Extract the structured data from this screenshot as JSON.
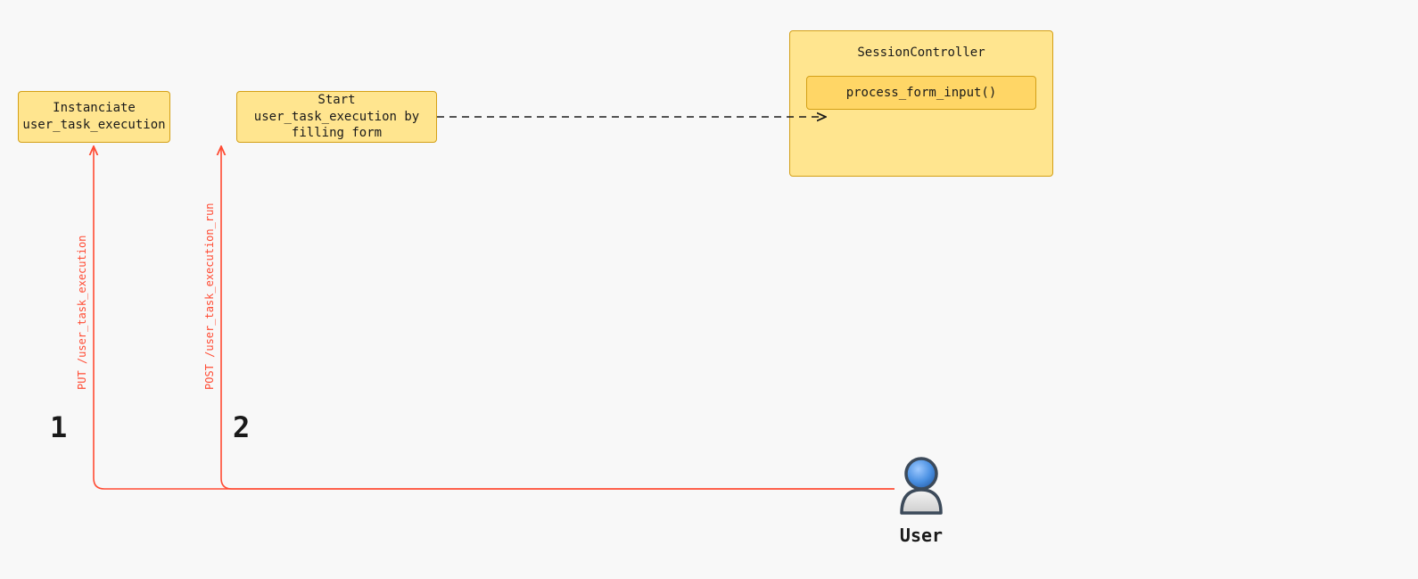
{
  "nodes": {
    "instanciate": {
      "line1": "Instanciate",
      "line2": "user_task_execution"
    },
    "start_form": {
      "line1": "Start user_task_execution by",
      "line2": "filling form"
    },
    "session_controller": {
      "title": "SessionController",
      "method": "process_form_input()"
    }
  },
  "actor": {
    "user_label": "User"
  },
  "steps": {
    "one": "1",
    "two": "2"
  },
  "edges": {
    "put_label": "PUT /user_task_execution",
    "post_label": "POST /user_task_execution_run"
  }
}
